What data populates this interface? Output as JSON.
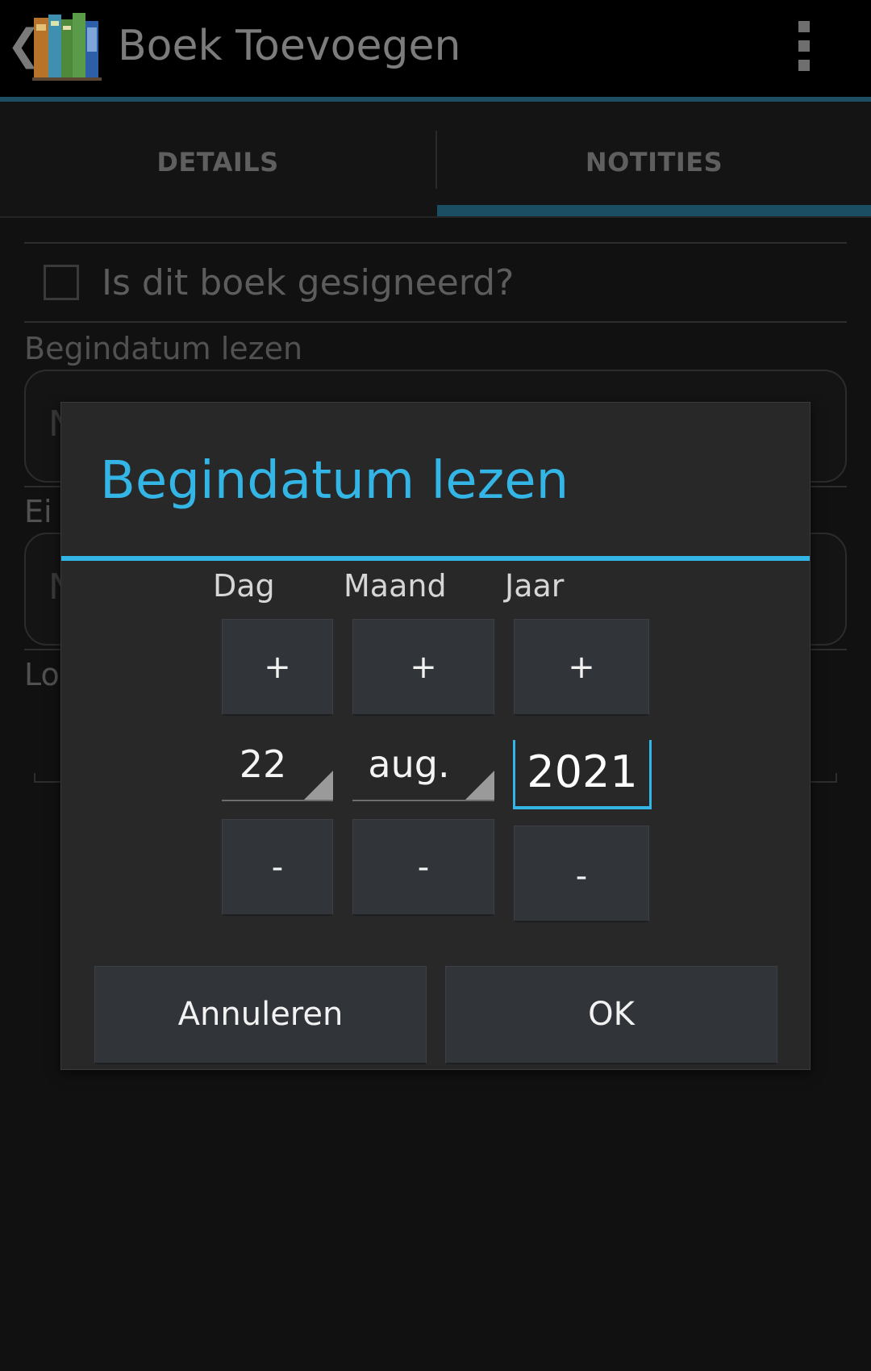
{
  "action_bar": {
    "up_icon": "back-caret-icon",
    "app_icon": "books-icon",
    "title": "Boek Toevoegen",
    "overflow_icon": "overflow-menu-icon"
  },
  "tabs": [
    {
      "label": "DETAILS",
      "selected": false
    },
    {
      "label": "NOTITIES",
      "selected": true
    }
  ],
  "form": {
    "signed_label": "Is dit boek gesigneerd?",
    "signed_checked": false,
    "start_date_label": "Begindatum lezen",
    "end_date_label_partial": "Ei",
    "start_date_partial": "N",
    "end_date_partial": "N",
    "location_label_partial": "Lo"
  },
  "dialog": {
    "title": "Begindatum lezen",
    "columns": {
      "day_label": "Dag",
      "month_label": "Maand",
      "year_label": "Jaar"
    },
    "plus_label": "+",
    "minus_label": "-",
    "day_value": "22",
    "month_value": "aug.",
    "year_value": "2021",
    "cancel_label": "Annuleren",
    "ok_label": "OK"
  },
  "colors": {
    "accent": "#33b5e5",
    "action_bar_underline": "#1d4e62",
    "dialog_bg": "#282828",
    "button_bg": "#31353a"
  }
}
